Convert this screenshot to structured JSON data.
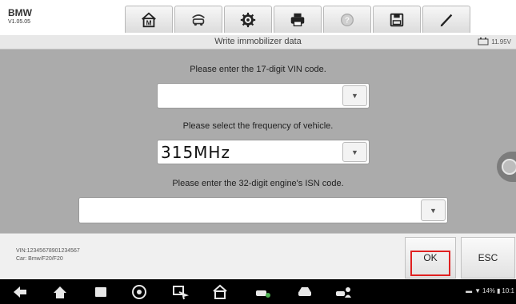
{
  "app": {
    "brand": "BMW",
    "version": "V1.05.05"
  },
  "toolbar": {
    "buttons": [
      {
        "name": "home-icon"
      },
      {
        "name": "vehicle-swap-icon"
      },
      {
        "name": "settings-gear-icon"
      },
      {
        "name": "print-icon"
      },
      {
        "name": "help-icon"
      },
      {
        "name": "save-icon"
      },
      {
        "name": "edit-icon"
      }
    ]
  },
  "titlebar": {
    "title": "Write immobilizer data",
    "voltage": "11.95V"
  },
  "form": {
    "vin_label": "Please enter the 17-digit VIN code.",
    "vin_value": "",
    "freq_label": "Please select the frequency of vehicle.",
    "freq_value": "315MHz",
    "isn_label": "Please enter the 32-digit engine's ISN code.",
    "isn_value": "",
    "dropdown_glyph": "▼"
  },
  "footer": {
    "vin": "VIN:12345678901234567",
    "car": "Car: Bmw/F20/F20",
    "ok_label": "OK",
    "esc_label": "ESC"
  },
  "statusbar": {
    "battery": "14%",
    "time": "10:1"
  },
  "colors": {
    "highlight": "#e02020",
    "body_bg": "#ababab"
  }
}
